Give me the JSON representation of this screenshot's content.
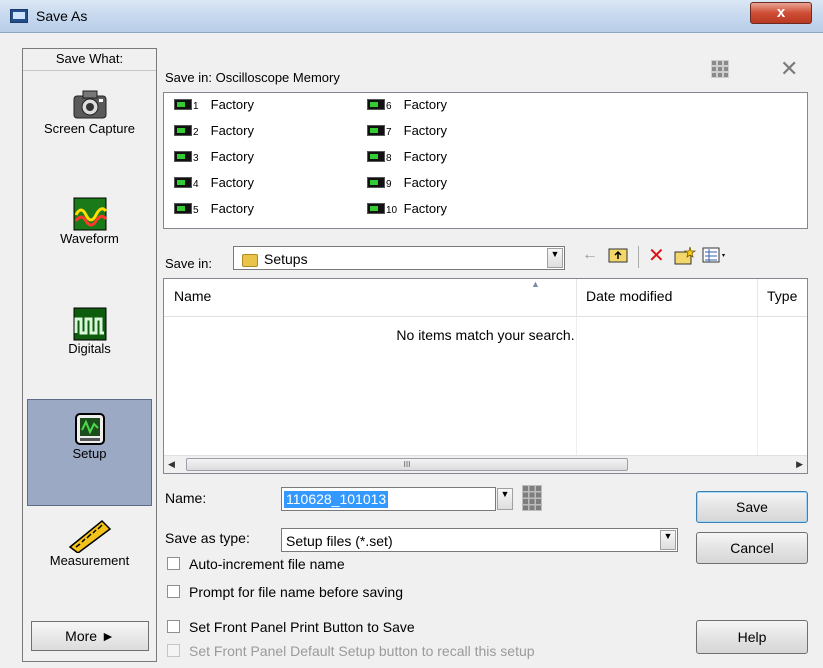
{
  "window": {
    "title": "Save As",
    "close_label": "x"
  },
  "sidebar": {
    "header": "Save What:",
    "items": [
      {
        "label": "Screen Capture"
      },
      {
        "label": "Waveform"
      },
      {
        "label": "Digitals"
      },
      {
        "label": "Setup",
        "selected": true
      },
      {
        "label": "Measurement"
      }
    ],
    "more_label": "More  ►"
  },
  "memory": {
    "label": "Save in: Oscilloscope Memory",
    "slots": [
      {
        "num": "1",
        "name": "Factory"
      },
      {
        "num": "2",
        "name": "Factory"
      },
      {
        "num": "3",
        "name": "Factory"
      },
      {
        "num": "4",
        "name": "Factory"
      },
      {
        "num": "5",
        "name": "Factory"
      },
      {
        "num": "6",
        "name": "Factory"
      },
      {
        "num": "7",
        "name": "Factory"
      },
      {
        "num": "8",
        "name": "Factory"
      },
      {
        "num": "9",
        "name": "Factory"
      },
      {
        "num": "10",
        "name": "Factory"
      }
    ]
  },
  "browser": {
    "save_in_label": "Save in:",
    "folder": "Setups",
    "columns": {
      "name": "Name",
      "date": "Date modified",
      "type": "Type"
    },
    "empty_message": "No items match your search.",
    "scroll_grip": "III"
  },
  "form": {
    "name_label": "Name:",
    "name_value": "110628_101013",
    "type_label": "Save as type:",
    "type_value": "Setup files (*.set)"
  },
  "buttons": {
    "save": "Save",
    "cancel": "Cancel",
    "help": "Help"
  },
  "options": {
    "auto_increment": "Auto-increment file name",
    "prompt": "Prompt for file name before saving",
    "front_panel_print": "Set Front Panel Print Button to Save",
    "front_panel_default": "Set Front Panel Default Setup button to recall this setup"
  },
  "colors": {
    "selection": "#3399ff",
    "sidebar_selected": "#9ca9c4",
    "close_button": "#cf4d35"
  }
}
